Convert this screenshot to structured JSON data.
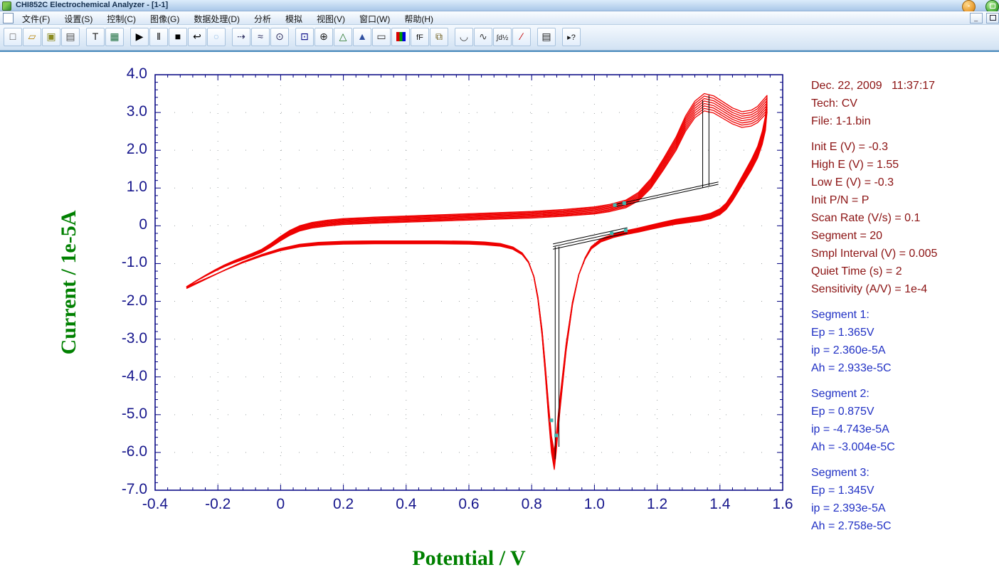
{
  "window": {
    "title": "CHI852C Electrochemical Analyzer - [1-1]",
    "controls": {
      "minimize": "-",
      "mdi_minimize": "_",
      "mdi_restore": ""
    }
  },
  "menu": {
    "items": [
      {
        "name": "menu-item-file",
        "label": "文件(F)"
      },
      {
        "name": "menu-item-setup",
        "label": "设置(S)"
      },
      {
        "name": "menu-item-control",
        "label": "控制(C)"
      },
      {
        "name": "menu-item-graphics",
        "label": "图像(G)"
      },
      {
        "name": "menu-item-data-processing",
        "label": "数据处理(D)"
      },
      {
        "name": "menu-item-analysis",
        "label": "分析"
      },
      {
        "name": "menu-item-simulation",
        "label": "模拟"
      },
      {
        "name": "menu-item-view",
        "label": "视图(V)"
      },
      {
        "name": "menu-item-window",
        "label": "窗口(W)"
      },
      {
        "name": "menu-item-help",
        "label": "帮助(H)"
      }
    ]
  },
  "toolbar": {
    "groups": [
      [
        {
          "name": "new-file-button",
          "glyph": "□",
          "color": "#404040"
        },
        {
          "name": "open-file-button",
          "glyph": "▱",
          "color": "#b8860b"
        },
        {
          "name": "save-button",
          "glyph": "▣",
          "color": "#8a8a20"
        },
        {
          "name": "print-button",
          "glyph": "▤",
          "color": "#505050"
        }
      ],
      [
        {
          "name": "text-tool-button",
          "glyph": "T",
          "color": "#202020"
        },
        {
          "name": "data-listing-button",
          "glyph": "▦",
          "color": "#207040"
        }
      ],
      [
        {
          "name": "run-experiment-button",
          "glyph": "▶",
          "color": "#000000"
        },
        {
          "name": "pause-button",
          "glyph": "‖",
          "color": "#000000"
        },
        {
          "name": "stop-button",
          "glyph": "■",
          "color": "#000000"
        },
        {
          "name": "reverse-scan-button",
          "glyph": "↩",
          "color": "#000000"
        },
        {
          "name": "cell-toggle-button",
          "glyph": "○",
          "color": "#9fc4e8"
        }
      ],
      [
        {
          "name": "step-technique-button",
          "glyph": "⇢",
          "color": "#303060"
        },
        {
          "name": "filter-settings-button",
          "glyph": "≈",
          "color": "#303060"
        },
        {
          "name": "timer-settings-button",
          "glyph": "⊙",
          "color": "#303060"
        }
      ],
      [
        {
          "name": "data-plot-button",
          "glyph": "⊡",
          "color": "#000080"
        },
        {
          "name": "zoom-in-button",
          "glyph": "⊕",
          "color": "#202020"
        },
        {
          "name": "peak-shape-button",
          "glyph": "△",
          "color": "#207020"
        },
        {
          "name": "peak-analysis-button",
          "glyph": "▲",
          "color": "#3050a0"
        },
        {
          "name": "presentation-button",
          "glyph": "▭",
          "color": "#303030"
        },
        {
          "name": "color-settings-button",
          "special": "rgb"
        },
        {
          "name": "font-settings-button",
          "glyph": "fF",
          "color": "#101010",
          "size": 11
        },
        {
          "name": "copy-to-clipboard-button",
          "glyph": "⧉",
          "color": "#706020"
        }
      ],
      [
        {
          "name": "smoothing-button",
          "glyph": "◡",
          "color": "#404040"
        },
        {
          "name": "derivative-button",
          "glyph": "∿",
          "color": "#404040"
        },
        {
          "name": "integration-button",
          "glyph": "∫d½",
          "color": "#202020",
          "size": 10
        },
        {
          "name": "baseline-slope-button",
          "glyph": "∕",
          "color": "#c00000"
        }
      ],
      [
        {
          "name": "report-button",
          "glyph": "▤",
          "color": "#202020"
        }
      ],
      [
        {
          "name": "context-help-button",
          "glyph": "▸?",
          "color": "#101010",
          "size": 11
        }
      ]
    ]
  },
  "chart_data": {
    "type": "line",
    "title": "",
    "xlabel": "Potential / V",
    "ylabel": "Current / 1e-5A",
    "xlim": [
      -0.4,
      1.6
    ],
    "ylim": [
      -7.0,
      4.0
    ],
    "xticks": [
      {
        "v": -0.4,
        "label": "-0.4"
      },
      {
        "v": -0.2,
        "label": "-0.2"
      },
      {
        "v": 0,
        "label": "0"
      },
      {
        "v": 0.2,
        "label": "0.2"
      },
      {
        "v": 0.4,
        "label": "0.4"
      },
      {
        "v": 0.6,
        "label": "0.6"
      },
      {
        "v": 0.8,
        "label": "0.8"
      },
      {
        "v": 1.0,
        "label": "1.0"
      },
      {
        "v": 1.2,
        "label": "1.2"
      },
      {
        "v": 1.4,
        "label": "1.4"
      },
      {
        "v": 1.6,
        "label": "1.6"
      }
    ],
    "yticks": [
      {
        "v": 4,
        "label": "4.0"
      },
      {
        "v": 3,
        "label": "3.0"
      },
      {
        "v": 2,
        "label": "2.0"
      },
      {
        "v": 1,
        "label": "1.0"
      },
      {
        "v": 0,
        "label": "0"
      },
      {
        "v": -1,
        "label": "-1.0"
      },
      {
        "v": -2,
        "label": "-2.0"
      },
      {
        "v": -3,
        "label": "-3.0"
      },
      {
        "v": -4,
        "label": "-4.0"
      },
      {
        "v": -5,
        "label": "-5.0"
      },
      {
        "v": -6,
        "label": "-6.0"
      },
      {
        "v": -7,
        "label": "-7.0"
      }
    ],
    "x_minor_step": 0.04,
    "y_minor_step": 0.2,
    "grid": {
      "style": "dotted",
      "color": "#9aa0a0",
      "x_step": 0.2,
      "y_step": 1.0
    },
    "frame_color": "#000080",
    "tick_label_color": "#16168c",
    "axis_label_color": "#008000",
    "curve_color": "#ee0000",
    "marker_color": "#000000",
    "anchor_color": "#3fb8b0",
    "cycles_shown": 10,
    "series": [
      {
        "name": "CV cycles",
        "forward": [
          [
            -0.3,
            -1.62
          ],
          [
            -0.27,
            -1.46
          ],
          [
            -0.24,
            -1.31
          ],
          [
            -0.21,
            -1.17
          ],
          [
            -0.18,
            -1.04
          ],
          [
            -0.15,
            -0.93
          ],
          [
            -0.12,
            -0.83
          ],
          [
            -0.09,
            -0.73
          ],
          [
            -0.06,
            -0.62
          ],
          [
            -0.03,
            -0.46
          ],
          [
            0.0,
            -0.28
          ],
          [
            0.03,
            -0.12
          ],
          [
            0.06,
            0.0
          ],
          [
            0.1,
            0.09
          ],
          [
            0.15,
            0.15
          ],
          [
            0.2,
            0.19
          ],
          [
            0.3,
            0.23
          ],
          [
            0.4,
            0.26
          ],
          [
            0.5,
            0.29
          ],
          [
            0.6,
            0.32
          ],
          [
            0.7,
            0.35
          ],
          [
            0.8,
            0.38
          ],
          [
            0.9,
            0.43
          ],
          [
            1.0,
            0.5
          ],
          [
            1.05,
            0.57
          ],
          [
            1.1,
            0.68
          ],
          [
            1.14,
            0.88
          ],
          [
            1.18,
            1.25
          ],
          [
            1.22,
            1.78
          ],
          [
            1.26,
            2.35
          ],
          [
            1.29,
            2.9
          ],
          [
            1.32,
            3.3
          ],
          [
            1.35,
            3.5
          ],
          [
            1.38,
            3.44
          ],
          [
            1.41,
            3.28
          ],
          [
            1.44,
            3.12
          ],
          [
            1.47,
            3.02
          ],
          [
            1.5,
            3.06
          ],
          [
            1.52,
            3.16
          ],
          [
            1.55,
            3.45
          ]
        ],
        "reverse": [
          [
            1.55,
            3.45
          ],
          [
            1.545,
            2.9
          ],
          [
            1.535,
            2.5
          ],
          [
            1.52,
            2.1
          ],
          [
            1.5,
            1.75
          ],
          [
            1.48,
            1.45
          ],
          [
            1.46,
            1.15
          ],
          [
            1.44,
            0.85
          ],
          [
            1.42,
            0.6
          ],
          [
            1.4,
            0.45
          ],
          [
            1.37,
            0.33
          ],
          [
            1.34,
            0.27
          ],
          [
            1.3,
            0.22
          ],
          [
            1.26,
            0.17
          ],
          [
            1.22,
            0.1
          ],
          [
            1.18,
            0.02
          ],
          [
            1.14,
            -0.06
          ],
          [
            1.1,
            -0.13
          ],
          [
            1.06,
            -0.22
          ],
          [
            1.02,
            -0.35
          ],
          [
            0.99,
            -0.55
          ],
          [
            0.97,
            -0.85
          ],
          [
            0.95,
            -1.3
          ],
          [
            0.93,
            -2.1
          ],
          [
            0.91,
            -3.3
          ],
          [
            0.89,
            -4.9
          ],
          [
            0.878,
            -6.0
          ],
          [
            0.872,
            -6.45
          ],
          [
            0.863,
            -6.0
          ],
          [
            0.853,
            -5.0
          ],
          [
            0.843,
            -3.9
          ],
          [
            0.833,
            -2.9
          ],
          [
            0.82,
            -1.95
          ],
          [
            0.807,
            -1.35
          ],
          [
            0.79,
            -0.95
          ],
          [
            0.77,
            -0.72
          ],
          [
            0.74,
            -0.56
          ],
          [
            0.7,
            -0.47
          ],
          [
            0.65,
            -0.43
          ],
          [
            0.6,
            -0.41
          ],
          [
            0.5,
            -0.4
          ],
          [
            0.4,
            -0.4
          ],
          [
            0.3,
            -0.4
          ],
          [
            0.2,
            -0.41
          ],
          [
            0.12,
            -0.44
          ],
          [
            0.06,
            -0.49
          ],
          [
            0.0,
            -0.6
          ],
          [
            -0.06,
            -0.76
          ],
          [
            -0.12,
            -0.95
          ],
          [
            -0.18,
            -1.18
          ],
          [
            -0.24,
            -1.42
          ],
          [
            -0.3,
            -1.66
          ]
        ]
      }
    ],
    "peak_marker_lines": [
      [
        1.065,
        0.5,
        1.395,
        1.1
      ],
      [
        1.065,
        0.56,
        1.395,
        1.16
      ],
      [
        1.345,
        3.32,
        1.345,
        1.01
      ],
      [
        1.365,
        3.46,
        1.365,
        1.06
      ],
      [
        0.868,
        -0.55,
        1.105,
        -0.12
      ],
      [
        0.868,
        -0.48,
        1.105,
        -0.05
      ],
      [
        0.868,
        -0.62,
        1.105,
        -0.19
      ],
      [
        0.875,
        -0.55,
        0.875,
        -6.18
      ],
      [
        0.887,
        -0.55,
        0.887,
        -5.85
      ]
    ],
    "anchor_points": [
      [
        1.065,
        0.55
      ],
      [
        1.095,
        0.6
      ],
      [
        1.055,
        -0.2
      ],
      [
        1.1,
        -0.12
      ],
      [
        0.863,
        -5.15
      ],
      [
        0.878,
        -5.55
      ]
    ]
  },
  "info_panel": {
    "text_color": "#8b1212",
    "result_color": "#2030c4",
    "header": [
      "Dec. 22, 2009   11:37:17",
      "Tech: CV",
      "File: 1-1.bin"
    ],
    "parameters": [
      "Init E (V) = -0.3",
      "High E (V) = 1.55",
      "Low E (V) = -0.3",
      "Init P/N = P",
      "Scan Rate (V/s) = 0.1",
      "Segment = 20",
      "Smpl Interval (V) = 0.005",
      "Quiet Time (s) = 2",
      "Sensitivity (A/V) = 1e-4"
    ],
    "segments": [
      {
        "title": "Segment 1:",
        "lines": [
          "Ep = 1.365V",
          "ip = 2.360e-5A",
          "Ah = 2.933e-5C"
        ]
      },
      {
        "title": "Segment 2:",
        "lines": [
          "Ep = 0.875V",
          "ip = -4.743e-5A",
          "Ah = -3.004e-5C"
        ]
      },
      {
        "title": "Segment 3:",
        "lines": [
          "Ep = 1.345V",
          "ip = 2.393e-5A",
          "Ah = 2.758e-5C"
        ]
      }
    ]
  }
}
